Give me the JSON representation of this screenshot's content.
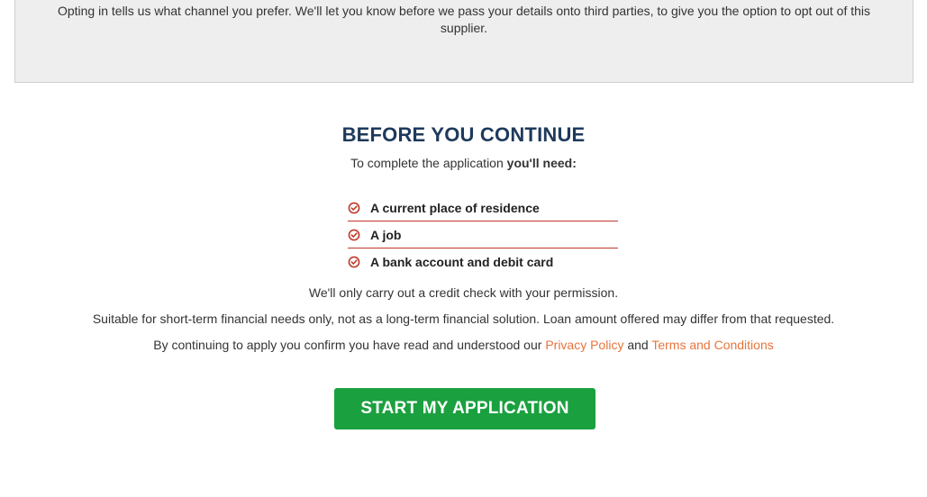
{
  "optin": {
    "text": "Opting in tells us what channel you prefer. We'll let you know before we pass your details onto third parties, to give you the option to opt out of this supplier."
  },
  "before": {
    "title": "BEFORE YOU CONTINUE",
    "subtitle_prefix": "To complete the application ",
    "subtitle_bold": "you'll need:",
    "requirements": [
      {
        "label": "A current place of residence",
        "icon": "check-circle-icon"
      },
      {
        "label": "A job",
        "icon": "check-circle-icon"
      },
      {
        "label": "A bank account and debit card",
        "icon": "check-circle-icon"
      }
    ],
    "credit_check": "We'll only carry out a credit check with your permission.",
    "suitability": "Suitable for short-term financial needs only, not as a long-term financial solution. Loan amount offered may differ from that requested.",
    "consent_prefix": "By continuing to apply you confirm you have read and understood our ",
    "privacy_link": "Privacy Policy",
    "consent_and": " and ",
    "terms_link": "Terms and Conditions"
  },
  "cta": {
    "label": "START MY APPLICATION"
  },
  "colors": {
    "accent": "#c0392b",
    "title": "#1e3a5c",
    "link": "#e8743b",
    "button": "#1ba03f"
  }
}
